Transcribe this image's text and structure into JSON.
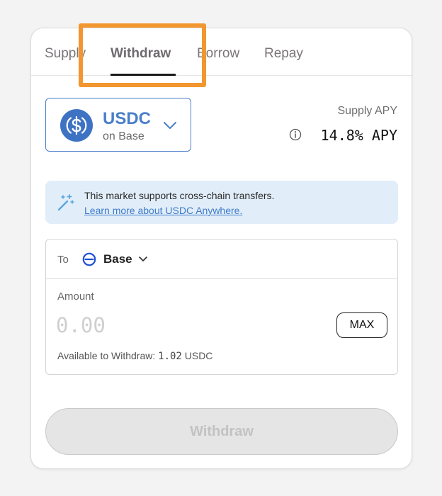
{
  "tabs": [
    {
      "label": "Supply",
      "active": false
    },
    {
      "label": "Withdraw",
      "active": true
    },
    {
      "label": "Borrow",
      "active": false
    },
    {
      "label": "Repay",
      "active": false
    }
  ],
  "asset": {
    "symbol": "USDC",
    "network": "on Base",
    "icon": "usdc-icon",
    "accent_color": "#4a7fc9"
  },
  "apy": {
    "label": "Supply APY",
    "value": "14.8% APY",
    "icon": "info-icon"
  },
  "notice": {
    "text": "This market supports cross-chain transfers.",
    "link": "Learn more about USDC Anywhere.",
    "icon": "magic-wand-icon",
    "background": "#e1eefa"
  },
  "destination": {
    "label": "To",
    "network": "Base",
    "icon": "base-network-icon"
  },
  "amount": {
    "label": "Amount",
    "placeholder": "0.00",
    "value": "",
    "max_label": "MAX"
  },
  "available": {
    "label": "Available to Withdraw:",
    "amount": "1.02",
    "unit": "USDC"
  },
  "submit": {
    "label": "Withdraw",
    "enabled": false
  },
  "highlight_color": "#f2962f"
}
